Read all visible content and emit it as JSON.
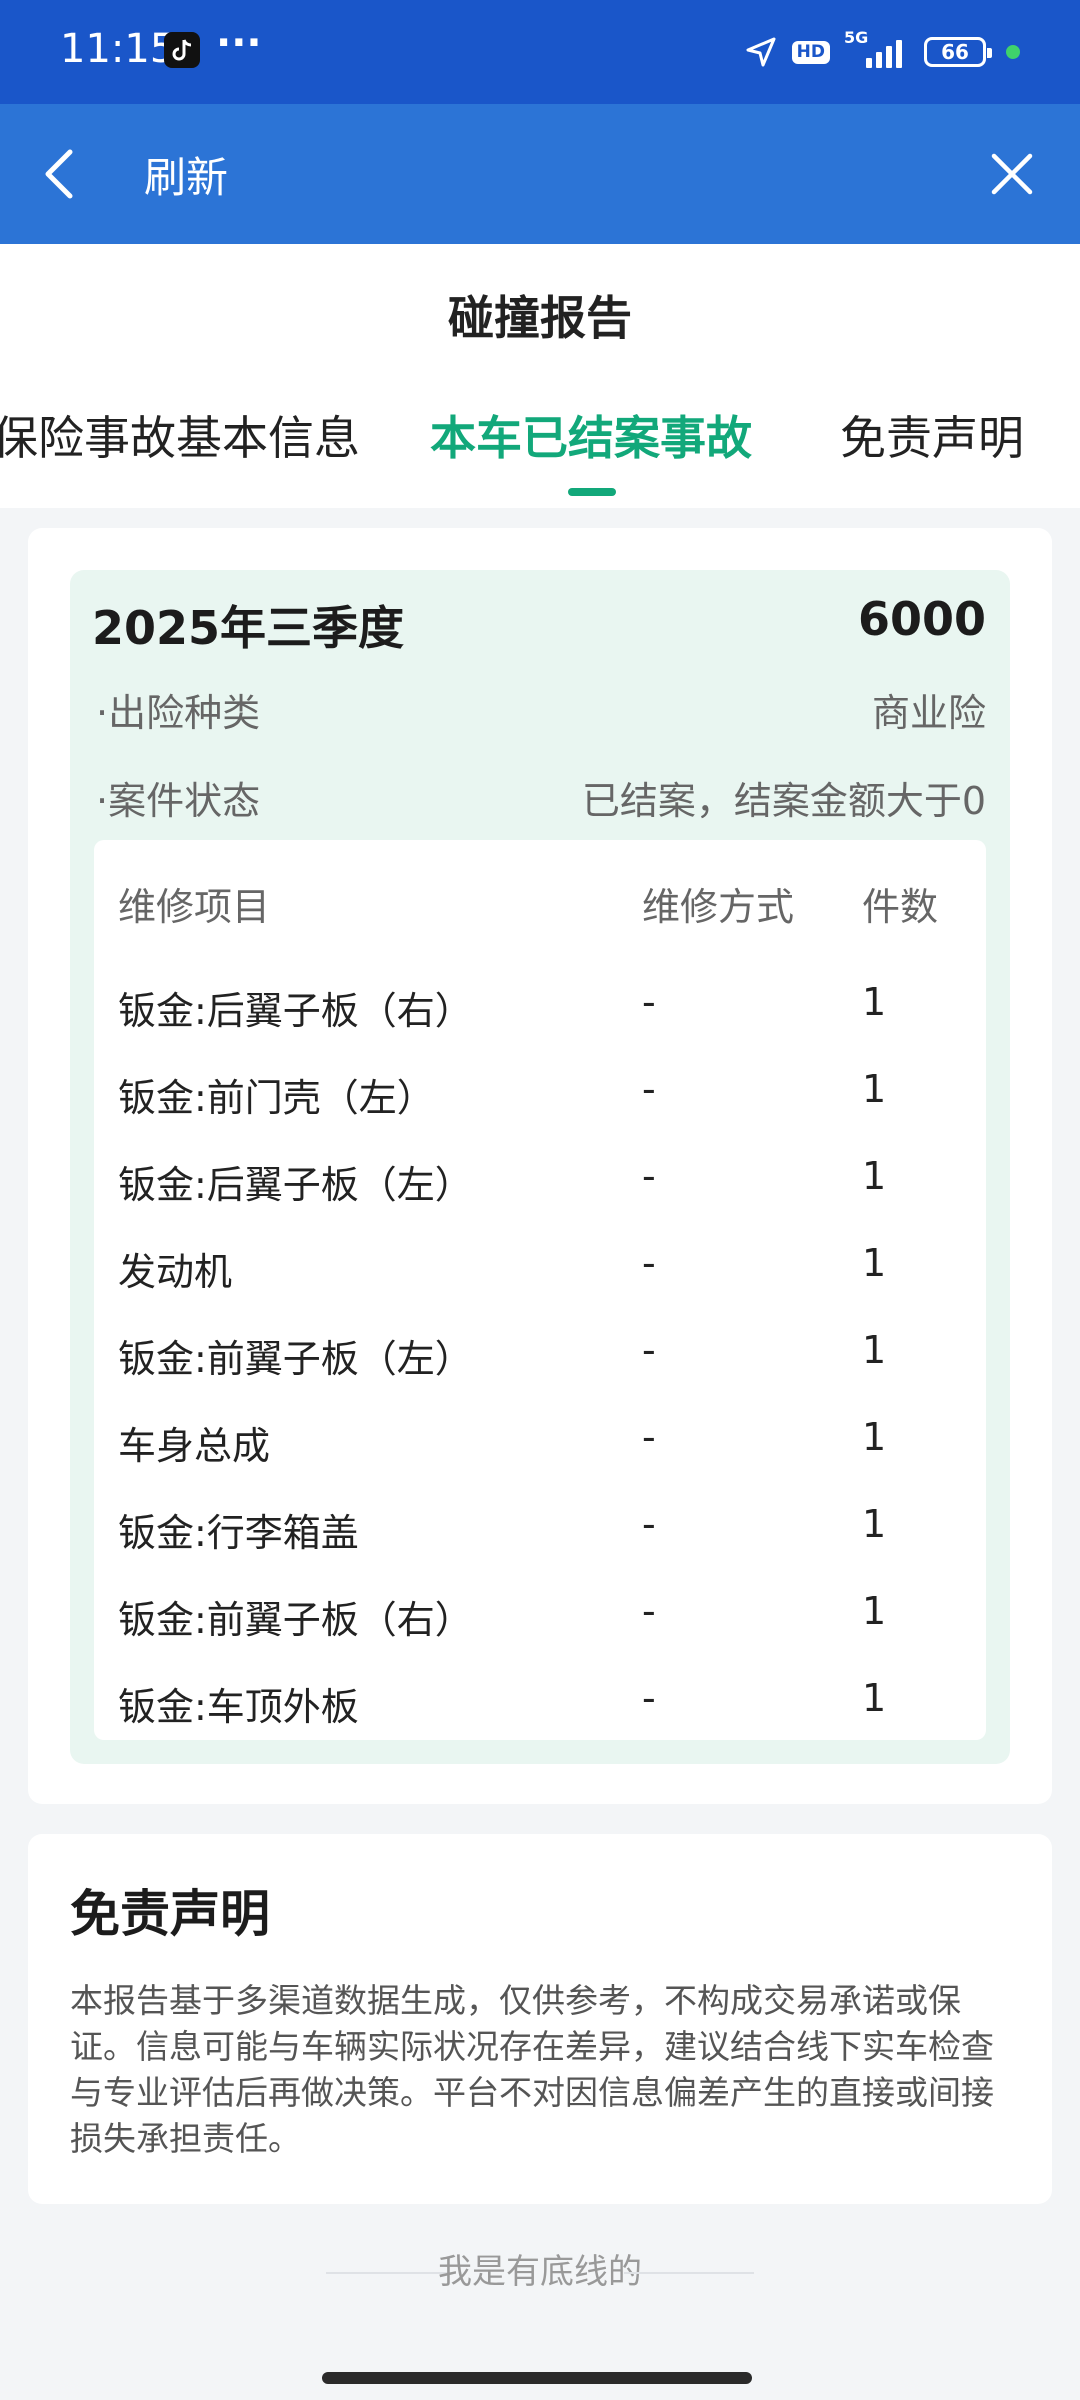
{
  "status_bar": {
    "time": "11:15",
    "more": "···",
    "hd_badge": "HD",
    "network": "5G",
    "battery": "66"
  },
  "nav": {
    "title": "刷新"
  },
  "page": {
    "title": "碰撞报告",
    "tabs": [
      {
        "label": "保险事故基本信息"
      },
      {
        "label": "本车已结案事故"
      },
      {
        "label": "免责声明"
      }
    ],
    "active_tab_index": 1
  },
  "claim": {
    "period": "2025年三季度",
    "amount": "6000",
    "info": [
      {
        "label": "·出险种类",
        "value": "商业险"
      },
      {
        "label": "·案件状态",
        "value": "已结案，结案金额大于0"
      }
    ],
    "table": {
      "headers": [
        "维修项目",
        "维修方式",
        "件数"
      ],
      "rows": [
        {
          "name": "钣金:后翼子板（右）",
          "method": "-",
          "count": "1"
        },
        {
          "name": "钣金:前门壳（左）",
          "method": "-",
          "count": "1"
        },
        {
          "name": "钣金:后翼子板（左）",
          "method": "-",
          "count": "1"
        },
        {
          "name": "发动机",
          "method": "-",
          "count": "1"
        },
        {
          "name": "钣金:前翼子板（左）",
          "method": "-",
          "count": "1"
        },
        {
          "name": "车身总成",
          "method": "-",
          "count": "1"
        },
        {
          "name": "钣金:行李箱盖",
          "method": "-",
          "count": "1"
        },
        {
          "name": "钣金:前翼子板（右）",
          "method": "-",
          "count": "1"
        },
        {
          "name": "钣金:车顶外板",
          "method": "-",
          "count": "1"
        }
      ]
    }
  },
  "disclaimer": {
    "title": "免责声明",
    "body": "本报告基于多渠道数据生成，仅供参考，不构成交易承诺或保证。信息可能与车辆实际状况存在差异，建议结合线下实车检查与专业评估后再做决策。平台不对因信息偏差产生的直接或间接损失承担责任。"
  },
  "footer": {
    "text": "我是有底线的"
  },
  "colors": {
    "status_bar": "#1a56c9",
    "nav_bar": "#2c74d6",
    "accent": "#12a87a",
    "card_tint": "#e9f6f1"
  }
}
